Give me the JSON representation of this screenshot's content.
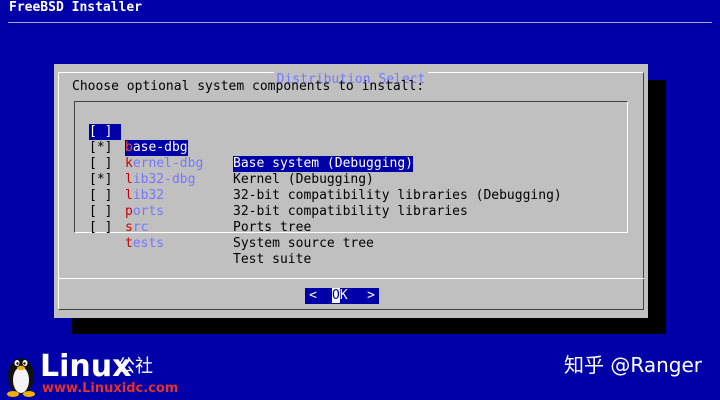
{
  "backtitle": "FreeBSD Installer",
  "dialog": {
    "title": "Distribution Select",
    "prompt": "Choose optional system components to install:",
    "items": [
      {
        "check": "[ ]",
        "hot": "b",
        "rest": "ase-dbg",
        "desc": "Base system (Debugging)",
        "selected": true
      },
      {
        "check": "[*]",
        "hot": "k",
        "rest": "ernel-dbg",
        "desc": "Kernel (Debugging)",
        "selected": false
      },
      {
        "check": "[ ]",
        "hot": "l",
        "rest": "ib32-dbg",
        "desc": "32-bit compatibility libraries (Debugging)",
        "selected": false
      },
      {
        "check": "[*]",
        "hot": "l",
        "rest": "ib32",
        "desc": "32-bit compatibility libraries",
        "selected": false
      },
      {
        "check": "[ ]",
        "hot": "p",
        "rest": "orts",
        "desc": "Ports tree",
        "selected": false
      },
      {
        "check": "[ ]",
        "hot": "s",
        "rest": "rc",
        "desc": "System source tree",
        "selected": false
      },
      {
        "check": "[ ]",
        "hot": "t",
        "rest": "ests",
        "desc": "Test suite",
        "selected": false
      }
    ],
    "ok_button": {
      "left": "<",
      "first": "O",
      "rest": "K",
      "right": ">"
    }
  },
  "logo": {
    "text": "Linux",
    "cn": "公社",
    "url": "www.Linuxidc.com"
  },
  "watermark": "知乎 @Ranger",
  "colors": {
    "background": "#0000a8",
    "dialog": "#c0c0c0",
    "highlight": "#0000a8",
    "item_name": "#7676ff",
    "hotkey": "#c80000"
  }
}
